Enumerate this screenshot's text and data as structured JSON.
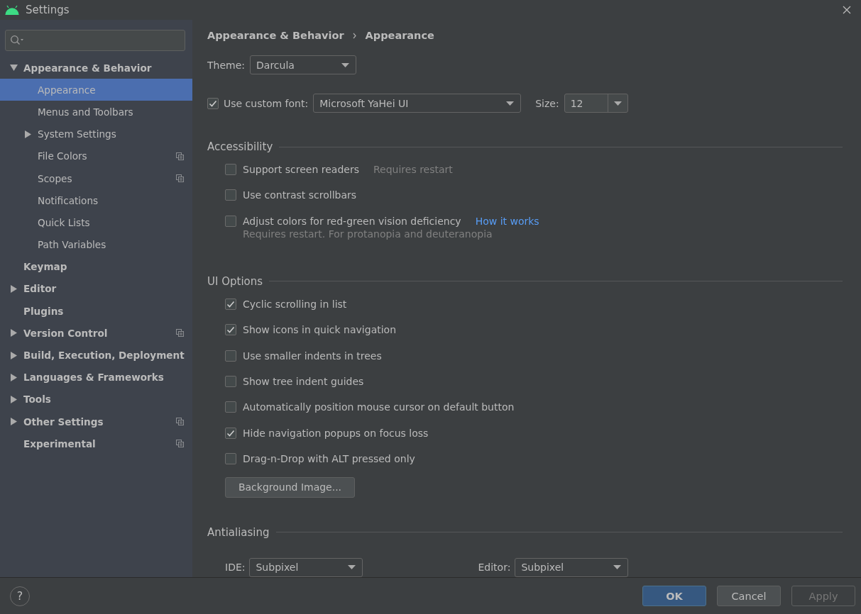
{
  "window": {
    "title": "Settings"
  },
  "sidebar": {
    "items": [
      {
        "label": "Appearance & Behavior",
        "expanded": true,
        "selected": false,
        "project_icon": false,
        "children": [
          {
            "label": "Appearance",
            "selected": true,
            "project_icon": false
          },
          {
            "label": "Menus and Toolbars",
            "selected": false,
            "project_icon": false
          },
          {
            "label": "System Settings",
            "expanded": false,
            "selected": false,
            "project_icon": false
          },
          {
            "label": "File Colors",
            "selected": false,
            "project_icon": true
          },
          {
            "label": "Scopes",
            "selected": false,
            "project_icon": true
          },
          {
            "label": "Notifications",
            "selected": false,
            "project_icon": false
          },
          {
            "label": "Quick Lists",
            "selected": false,
            "project_icon": false
          },
          {
            "label": "Path Variables",
            "selected": false,
            "project_icon": false
          }
        ]
      },
      {
        "label": "Keymap",
        "selected": false,
        "project_icon": false
      },
      {
        "label": "Editor",
        "expanded": false,
        "selected": false,
        "project_icon": false
      },
      {
        "label": "Plugins",
        "selected": false,
        "project_icon": false
      },
      {
        "label": "Version Control",
        "expanded": false,
        "selected": false,
        "project_icon": true
      },
      {
        "label": "Build, Execution, Deployment",
        "expanded": false,
        "selected": false,
        "project_icon": false
      },
      {
        "label": "Languages & Frameworks",
        "expanded": false,
        "selected": false,
        "project_icon": false
      },
      {
        "label": "Tools",
        "expanded": false,
        "selected": false,
        "project_icon": false
      },
      {
        "label": "Other Settings",
        "expanded": false,
        "selected": false,
        "project_icon": true
      },
      {
        "label": "Experimental",
        "selected": false,
        "project_icon": true
      }
    ]
  },
  "breadcrumb": [
    "Appearance & Behavior",
    "Appearance"
  ],
  "theme": {
    "label": "Theme:",
    "value": "Darcula"
  },
  "custom_font": {
    "label": "Use custom font:",
    "checked": true,
    "value": "Microsoft YaHei UI",
    "size_label": "Size:",
    "size": "12"
  },
  "sections": [
    {
      "title": "Accessibility",
      "options": [
        {
          "label": "Support screen readers",
          "checked": false,
          "note": "Requires restart"
        },
        {
          "label": "Use contrast scrollbars",
          "checked": false
        },
        {
          "label": "Adjust colors for red-green vision deficiency",
          "checked": false,
          "link": "How it works",
          "hint": "Requires restart. For protanopia and deuteranopia"
        }
      ]
    },
    {
      "title": "UI Options",
      "options": [
        {
          "label": "Cyclic scrolling in list",
          "checked": true
        },
        {
          "label": "Show icons in quick navigation",
          "checked": true
        },
        {
          "label": "Use smaller indents in trees",
          "checked": false
        },
        {
          "label": "Show tree indent guides",
          "checked": false
        },
        {
          "label": "Automatically position mouse cursor on default button",
          "checked": false
        },
        {
          "label": "Hide navigation popups on focus loss",
          "checked": true
        },
        {
          "label": "Drag-n-Drop with ALT pressed only",
          "checked": false
        }
      ],
      "button": "Background Image..."
    },
    {
      "title": "Antialiasing",
      "selects": [
        {
          "label": "IDE:",
          "value": "Subpixel"
        },
        {
          "label": "Editor:",
          "value": "Subpixel"
        }
      ]
    }
  ],
  "help": "?",
  "buttons": [
    {
      "label": "OK",
      "kind": "default"
    },
    {
      "label": "Cancel",
      "kind": "normal"
    },
    {
      "label": "Apply",
      "kind": "disabled"
    }
  ]
}
